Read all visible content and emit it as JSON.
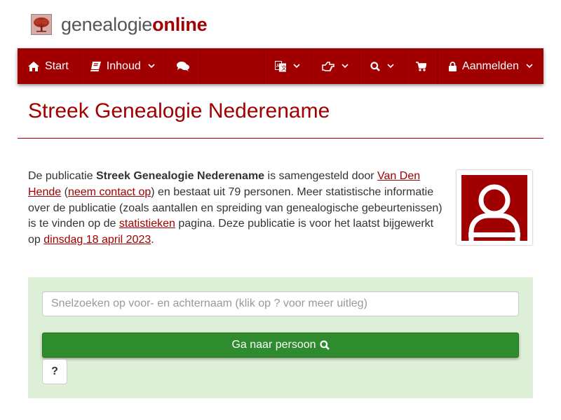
{
  "header": {
    "logo_text_main": "genealogie",
    "logo_text_accent": "online"
  },
  "nav": {
    "start_label": "Start",
    "inhoud_label": "Inhoud",
    "login_label": "Aanmelden",
    "icons": [
      "home-icon",
      "book-icon",
      "comments-icon",
      "translate-icon",
      "hand-pointer-icon",
      "search-icon",
      "cart-icon",
      "lock-icon"
    ]
  },
  "page": {
    "title": "Streek Genealogie Nederename"
  },
  "description": {
    "t1": "De publicatie ",
    "pub_name": "Streek Genealogie Nederename",
    "t2": " is samengesteld door ",
    "author_link": "Van Den Hende",
    "t3": " (",
    "contact_link": "neem contact op",
    "t4": ") en bestaat uit 79 personen. Meer statistische informatie over de publicatie (zoals aantallen en spreiding van genealogische gebeurtenissen) is te vinden op de ",
    "stats_link": "statistieken",
    "t5": " pagina. Deze publicatie is voor het laatst bijgewerkt op ",
    "date_link": "dinsdag 18 april 2023",
    "t6": "."
  },
  "search": {
    "placeholder": "Snelzoeken op voor- en achternaam (klik op ? voor meer uitleg)",
    "go_label": "Ga naar persoon",
    "help_label": "?"
  },
  "colors": {
    "brand": "#a00000",
    "button_green": "#2e8b2e",
    "panel_green": "#dff0d8"
  }
}
